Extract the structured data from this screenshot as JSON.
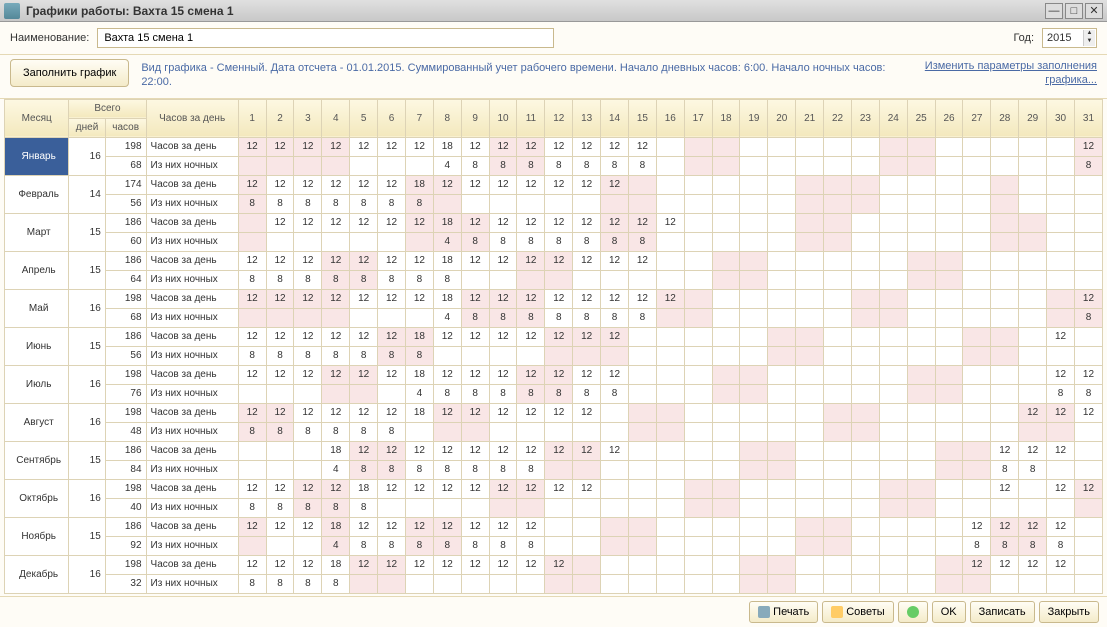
{
  "title": "Графики работы: Вахта 15 смена 1",
  "name_label": "Наименование:",
  "name_value": "Вахта 15 смена 1",
  "year_label": "Год:",
  "year_value": "2015",
  "fill_btn": "Заполнить график",
  "info": "Вид графика - Сменный. Дата отсчета - 01.01.2015. Суммированный учет рабочего времени. Начало дневных часов: 6:00. Начало ночных часов: 22:00.",
  "link": "Изменить параметры заполнения графика...",
  "hdr": {
    "month": "Месяц",
    "total": "Всего",
    "perday": "Часов за день",
    "days": "дней",
    "hours": "часов"
  },
  "row_labels": {
    "hours": "Часов за день",
    "night": "Из них ночных"
  },
  "footer": {
    "print": "Печать",
    "hints": "Советы",
    "ok": "OK",
    "save": "Записать",
    "close": "Закрыть"
  },
  "chart_data": {
    "type": "table",
    "columns_days": 31,
    "weekend_days_style": "pink",
    "months": [
      {
        "name": "Январь",
        "days": 16,
        "hours": 198,
        "night": 68,
        "pink": [
          1,
          2,
          3,
          4,
          10,
          11,
          17,
          18,
          24,
          25,
          31
        ],
        "d": {
          "1": 12,
          "2": 12,
          "3": 12,
          "4": 12,
          "5": 12,
          "6": 12,
          "7": 12,
          "8": 18,
          "9": 12,
          "10": 12,
          "11": 12,
          "12": 12,
          "13": 12,
          "14": 12,
          "15": 12,
          "31": 12
        },
        "n": {
          "8": 4,
          "9": 8,
          "10": 8,
          "11": 8,
          "12": 8,
          "13": 8,
          "14": 8,
          "15": 8,
          "31": 8
        }
      },
      {
        "name": "Февраль",
        "days": 14,
        "hours": 174,
        "night": 56,
        "pink": [
          1,
          7,
          8,
          14,
          15,
          21,
          22,
          23,
          28
        ],
        "d": {
          "1": 12,
          "2": 12,
          "3": 12,
          "4": 12,
          "5": 12,
          "6": 12,
          "7": 18,
          "8": 12,
          "9": 12,
          "10": 12,
          "11": 12,
          "12": 12,
          "13": 12,
          "14": 12
        },
        "n": {
          "1": 8,
          "2": 8,
          "3": 8,
          "4": 8,
          "5": 8,
          "6": 8,
          "7": 8
        }
      },
      {
        "name": "Март",
        "days": 15,
        "hours": 186,
        "night": 60,
        "pink": [
          1,
          7,
          8,
          9,
          14,
          15,
          21,
          22,
          28,
          29
        ],
        "d": {
          "2": 12,
          "3": 12,
          "4": 12,
          "5": 12,
          "6": 12,
          "7": 12,
          "8": 18,
          "9": 12,
          "10": 12,
          "11": 12,
          "12": 12,
          "13": 12,
          "14": 12,
          "15": 12,
          "16": 12
        },
        "n": {
          "8": 4,
          "9": 8,
          "10": 8,
          "11": 8,
          "12": 8,
          "13": 8,
          "14": 8,
          "15": 8
        }
      },
      {
        "name": "Апрель",
        "days": 15,
        "hours": 186,
        "night": 64,
        "pink": [
          4,
          5,
          11,
          12,
          18,
          19,
          25,
          26
        ],
        "d": {
          "1": 12,
          "2": 12,
          "3": 12,
          "4": 12,
          "5": 12,
          "6": 12,
          "7": 12,
          "8": 18,
          "9": 12,
          "10": 12,
          "11": 12,
          "12": 12,
          "13": 12,
          "14": 12,
          "15": 12
        },
        "n": {
          "1": 8,
          "2": 8,
          "3": 8,
          "4": 8,
          "5": 8,
          "6": 8,
          "7": 8,
          "8": 8
        }
      },
      {
        "name": "Май",
        "days": 16,
        "hours": 198,
        "night": 68,
        "pink": [
          1,
          2,
          3,
          4,
          9,
          10,
          11,
          16,
          17,
          23,
          24,
          30,
          31
        ],
        "d": {
          "1": 12,
          "2": 12,
          "3": 12,
          "4": 12,
          "5": 12,
          "6": 12,
          "7": 12,
          "8": 18,
          "9": 12,
          "10": 12,
          "11": 12,
          "12": 12,
          "13": 12,
          "14": 12,
          "15": 12,
          "16": 12,
          "31": 12
        },
        "n": {
          "8": 4,
          "9": 8,
          "10": 8,
          "11": 8,
          "12": 8,
          "13": 8,
          "14": 8,
          "15": 8,
          "31": 8
        }
      },
      {
        "name": "Июнь",
        "days": 15,
        "hours": 186,
        "night": 56,
        "pink": [
          6,
          7,
          12,
          13,
          14,
          20,
          21,
          27,
          28
        ],
        "d": {
          "1": 12,
          "2": 12,
          "3": 12,
          "4": 12,
          "5": 12,
          "6": 12,
          "7": 18,
          "8": 12,
          "9": 12,
          "10": 12,
          "11": 12,
          "12": 12,
          "13": 12,
          "14": 12,
          "30": 12
        },
        "n": {
          "1": 8,
          "2": 8,
          "3": 8,
          "4": 8,
          "5": 8,
          "6": 8,
          "7": 8
        }
      },
      {
        "name": "Июль",
        "days": 16,
        "hours": 198,
        "night": 76,
        "pink": [
          4,
          5,
          11,
          12,
          18,
          19,
          25,
          26
        ],
        "d": {
          "1": 12,
          "2": 12,
          "3": 12,
          "4": 12,
          "5": 12,
          "6": 12,
          "7": 18,
          "8": 12,
          "9": 12,
          "10": 12,
          "11": 12,
          "12": 12,
          "13": 12,
          "14": 12,
          "30": 12,
          "31": 12
        },
        "n": {
          "7": 4,
          "8": 8,
          "9": 8,
          "10": 8,
          "11": 8,
          "12": 8,
          "13": 8,
          "14": 8,
          "30": 8,
          "31": 8
        }
      },
      {
        "name": "Август",
        "days": 16,
        "hours": 198,
        "night": 48,
        "pink": [
          1,
          2,
          8,
          9,
          15,
          16,
          22,
          23,
          29,
          30
        ],
        "d": {
          "1": 12,
          "2": 12,
          "3": 12,
          "4": 12,
          "5": 12,
          "6": 12,
          "7": 18,
          "8": 12,
          "9": 12,
          "10": 12,
          "11": 12,
          "12": 12,
          "13": 12,
          "29": 12,
          "30": 12,
          "31": 12
        },
        "n": {
          "1": 8,
          "2": 8,
          "3": 8,
          "4": 8,
          "5": 8,
          "6": 8
        }
      },
      {
        "name": "Сентябрь",
        "days": 15,
        "hours": 186,
        "night": 84,
        "pink": [
          5,
          6,
          12,
          13,
          19,
          20,
          26,
          27
        ],
        "d": {
          "4": 18,
          "5": 12,
          "6": 12,
          "7": 12,
          "8": 12,
          "9": 12,
          "10": 12,
          "11": 12,
          "12": 12,
          "13": 12,
          "14": 12,
          "28": 12,
          "29": 12,
          "30": 12
        },
        "n": {
          "4": 4,
          "5": 8,
          "6": 8,
          "7": 8,
          "8": 8,
          "9": 8,
          "10": 8,
          "11": 8,
          "28": 8,
          "29": 8
        }
      },
      {
        "name": "Октябрь",
        "days": 16,
        "hours": 198,
        "night": 40,
        "pink": [
          3,
          4,
          10,
          11,
          17,
          18,
          24,
          25,
          31
        ],
        "d": {
          "1": 12,
          "2": 12,
          "3": 12,
          "4": 12,
          "5": 18,
          "6": 12,
          "7": 12,
          "8": 12,
          "9": 12,
          "10": 12,
          "11": 12,
          "12": 12,
          "13": 12,
          "28": 12,
          "30": 12,
          "31": 12
        },
        "n": {
          "1": 8,
          "2": 8,
          "3": 8,
          "4": 8,
          "5": 8
        }
      },
      {
        "name": "Ноябрь",
        "days": 15,
        "hours": 186,
        "night": 92,
        "pink": [
          1,
          4,
          7,
          8,
          14,
          15,
          21,
          22,
          28,
          29
        ],
        "d": {
          "1": 12,
          "2": 12,
          "3": 12,
          "4": 18,
          "5": 12,
          "6": 12,
          "7": 12,
          "8": 12,
          "9": 12,
          "10": 12,
          "11": 12,
          "27": 12,
          "28": 12,
          "29": 12,
          "30": 12
        },
        "n": {
          "4": 4,
          "5": 8,
          "6": 8,
          "7": 8,
          "8": 8,
          "9": 8,
          "10": 8,
          "11": 8,
          "27": 8,
          "28": 8,
          "29": 8,
          "30": 8
        }
      },
      {
        "name": "Декабрь",
        "days": 16,
        "hours": 198,
        "night": 32,
        "pink": [
          5,
          6,
          12,
          13,
          19,
          20,
          26,
          27
        ],
        "d": {
          "1": 12,
          "2": 12,
          "3": 12,
          "4": 18,
          "5": 12,
          "6": 12,
          "7": 12,
          "8": 12,
          "9": 12,
          "10": 12,
          "11": 12,
          "12": 12,
          "27": 12,
          "28": 12,
          "29": 12,
          "30": 12
        },
        "n": {
          "1": 8,
          "2": 8,
          "3": 8,
          "4": 8
        }
      }
    ]
  }
}
